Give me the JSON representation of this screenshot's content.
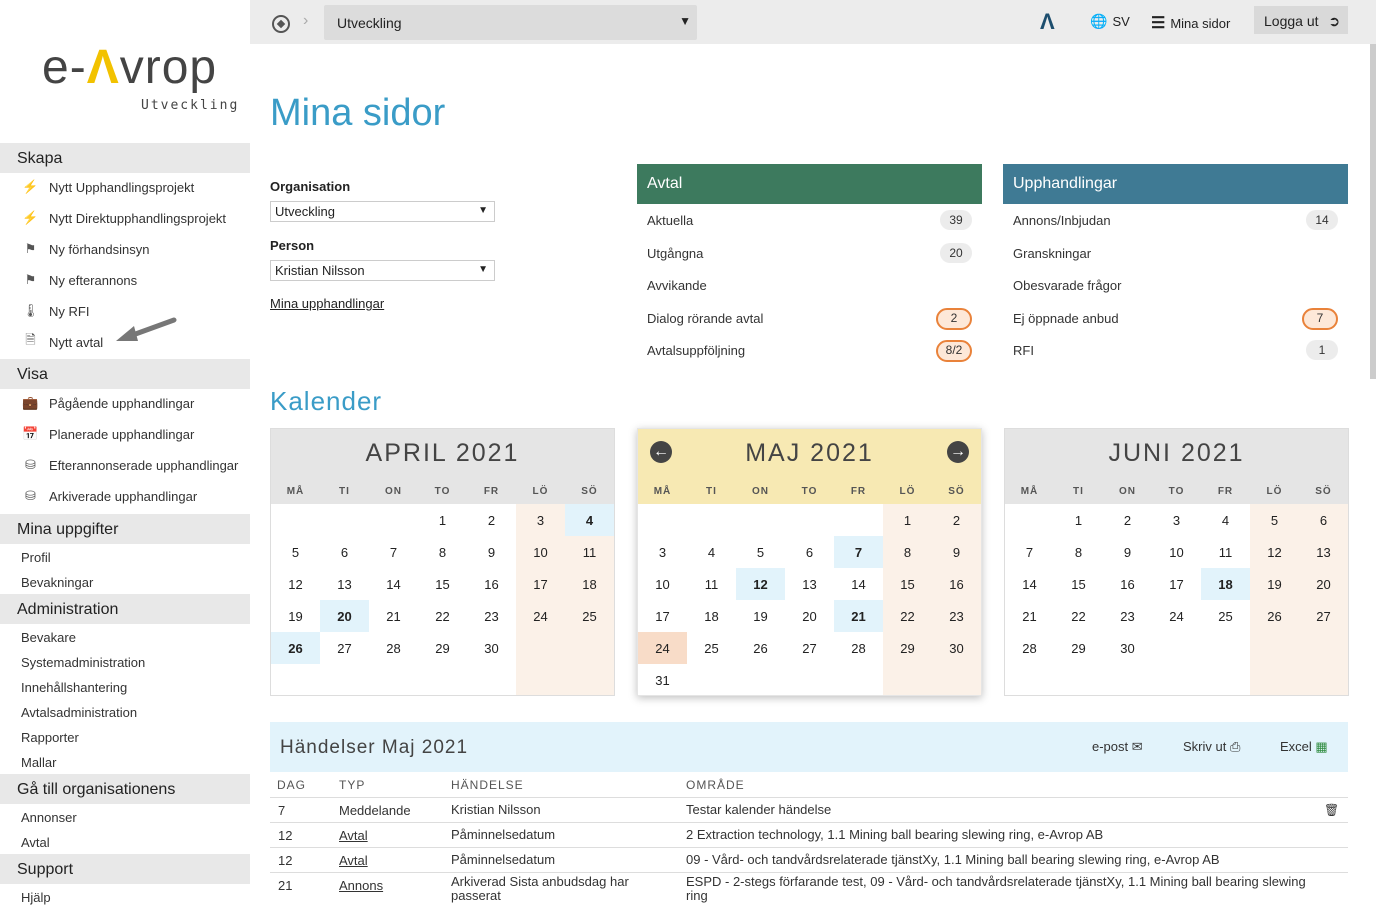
{
  "sidebar": {
    "logo": {
      "brand": "e-Avrop",
      "sub": "Utveckling"
    },
    "sections": [
      {
        "title": "Skapa",
        "items": [
          {
            "label": "Nytt Upphandlingsprojekt",
            "icon": "lightning-file-icon"
          },
          {
            "label": "Nytt Direktupphandlingsprojekt",
            "icon": "lightning-file-icon"
          },
          {
            "label": "Ny förhandsinsyn",
            "icon": "flag-icon"
          },
          {
            "label": "Ny efterannons",
            "icon": "flag-icon"
          },
          {
            "label": "Ny RFI",
            "icon": "thermometer-icon"
          },
          {
            "label": "Nytt avtal",
            "icon": "document-icon"
          }
        ]
      },
      {
        "title": "Visa",
        "items": [
          {
            "label": "Pågående upphandlingar",
            "icon": "briefcase-icon"
          },
          {
            "label": "Planerade upphandlingar",
            "icon": "calendar-icon"
          },
          {
            "label": "Efterannonserade upphandlingar",
            "icon": "database-icon"
          },
          {
            "label": "Arkiverade upphandlingar",
            "icon": "database-icon"
          }
        ]
      },
      {
        "title": "Mina uppgifter",
        "items": [
          {
            "label": "Profil"
          },
          {
            "label": "Bevakningar"
          }
        ]
      },
      {
        "title": "Administration",
        "items": [
          {
            "label": "Bevakare"
          },
          {
            "label": "Systemadministration"
          },
          {
            "label": "Innehållshantering"
          },
          {
            "label": "Avtalsadministration"
          },
          {
            "label": "Rapporter"
          },
          {
            "label": "Mallar"
          }
        ]
      },
      {
        "title": "Gå till organisationens",
        "items": [
          {
            "label": "Annonser"
          },
          {
            "label": "Avtal"
          }
        ]
      },
      {
        "title": "Support",
        "items": [
          {
            "label": "Hjälp"
          }
        ]
      }
    ]
  },
  "topbar": {
    "org_select": "Utveckling",
    "lang": "SV",
    "menu": "Mina sidor",
    "logout": "Logga ut"
  },
  "page": {
    "title": "Mina sidor",
    "org_label": "Organisation",
    "org_value": "Utveckling",
    "person_label": "Person",
    "person_value": "Kristian Nilsson",
    "my_link": "Mina upphandlingar"
  },
  "panels": {
    "avtal": {
      "title": "Avtal",
      "color": "#3d7a5e",
      "rows": [
        {
          "label": "Aktuella",
          "count": "39",
          "warn": false
        },
        {
          "label": "Utgångna",
          "count": "20",
          "warn": false
        },
        {
          "label": "Avvikande",
          "count": "",
          "warn": false
        },
        {
          "label": "Dialog rörande avtal",
          "count": "2",
          "warn": true
        },
        {
          "label": "Avtalsuppföljning",
          "count": "8/2",
          "warn": true
        }
      ]
    },
    "upphandlingar": {
      "title": "Upphandlingar",
      "color": "#3f7a94",
      "rows": [
        {
          "label": "Annons/Inbjudan",
          "count": "14",
          "warn": false
        },
        {
          "label": "Granskningar",
          "count": "",
          "warn": false
        },
        {
          "label": "Obesvarade frågor",
          "count": "",
          "warn": false
        },
        {
          "label": "Ej öppnade anbud",
          "count": "7",
          "warn": true
        },
        {
          "label": "RFI",
          "count": "1",
          "warn": false
        }
      ]
    }
  },
  "calendar": {
    "title": "Kalender",
    "dow": [
      "MÅ",
      "TI",
      "ON",
      "TO",
      "FR",
      "LÖ",
      "SÖ"
    ],
    "months": [
      {
        "title": "APRIL 2021",
        "offset": 3,
        "days": 30,
        "highlight": [
          4,
          20,
          26
        ],
        "today": null,
        "active": false
      },
      {
        "title": "MAJ 2021",
        "offset": 5,
        "days": 31,
        "highlight": [
          7,
          12,
          21
        ],
        "today": 24,
        "active": true
      },
      {
        "title": "JUNI 2021",
        "offset": 1,
        "days": 30,
        "highlight": [
          18
        ],
        "today": null,
        "active": false
      }
    ]
  },
  "events": {
    "title": "Händelser Maj 2021",
    "actions": {
      "email": "e-post",
      "print": "Skriv ut",
      "excel": "Excel"
    },
    "columns": [
      "DAG",
      "TYP",
      "HÄNDELSE",
      "OMRÅDE"
    ],
    "rows": [
      {
        "day": "7",
        "type": "Meddelande",
        "type_link": false,
        "event": "Kristian Nilsson",
        "area": "Testar kalender händelse",
        "delete": true
      },
      {
        "day": "12",
        "type": "Avtal",
        "type_link": true,
        "event": "Påminnelsedatum",
        "area": "2 Extraction technology, 1.1 Mining ball bearing slewing ring, e-Avrop AB",
        "delete": false
      },
      {
        "day": "12",
        "type": "Avtal",
        "type_link": true,
        "event": "Påminnelsedatum",
        "area": "09 - Vård- och tandvårdsrelaterade tjänstXy, 1.1 Mining ball bearing slewing ring, e-Avrop AB",
        "delete": false
      },
      {
        "day": "21",
        "type": "Annons",
        "type_link": true,
        "event": "Arkiverad Sista anbudsdag har passerat",
        "area": "ESPD - 2-stegs förfarande test, 09 - Vård- och tandvårdsrelaterade tjänstXy, 1.1 Mining ball bearing slewing ring",
        "delete": false
      }
    ]
  }
}
